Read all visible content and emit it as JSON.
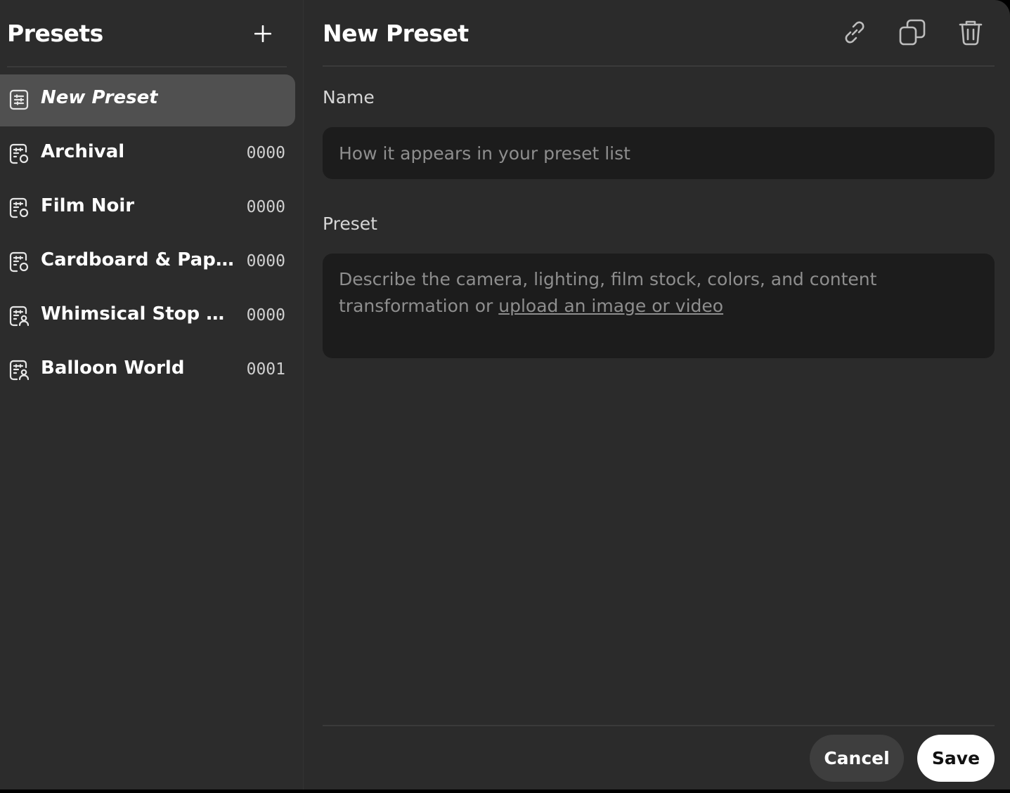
{
  "sidebar": {
    "title": "Presets",
    "items": [
      {
        "label": "New Preset",
        "count": "",
        "icon": "preset-list-icon",
        "active": true
      },
      {
        "label": "Archival",
        "count": "0000",
        "icon": "preset-object-icon"
      },
      {
        "label": "Film Noir",
        "count": "0000",
        "icon": "preset-object-icon"
      },
      {
        "label": "Cardboard & Paperc...",
        "count": "0000",
        "icon": "preset-object-icon"
      },
      {
        "label": "Whimsical Stop Mot...",
        "count": "0000",
        "icon": "preset-person-icon"
      },
      {
        "label": "Balloon World",
        "count": "0001",
        "icon": "preset-person-icon"
      }
    ]
  },
  "main": {
    "title": "New Preset",
    "name_label": "Name",
    "name_placeholder": "How it appears in your preset list",
    "preset_label": "Preset",
    "preset_placeholder_text": "Describe the camera, lighting, film stock, colors, and content transformation or ",
    "preset_placeholder_link": "upload an image or video",
    "cancel_label": "Cancel",
    "save_label": "Save"
  },
  "colors": {
    "panel": "#2b2b2b",
    "field": "#1c1c1c",
    "active_item": "#505050"
  }
}
